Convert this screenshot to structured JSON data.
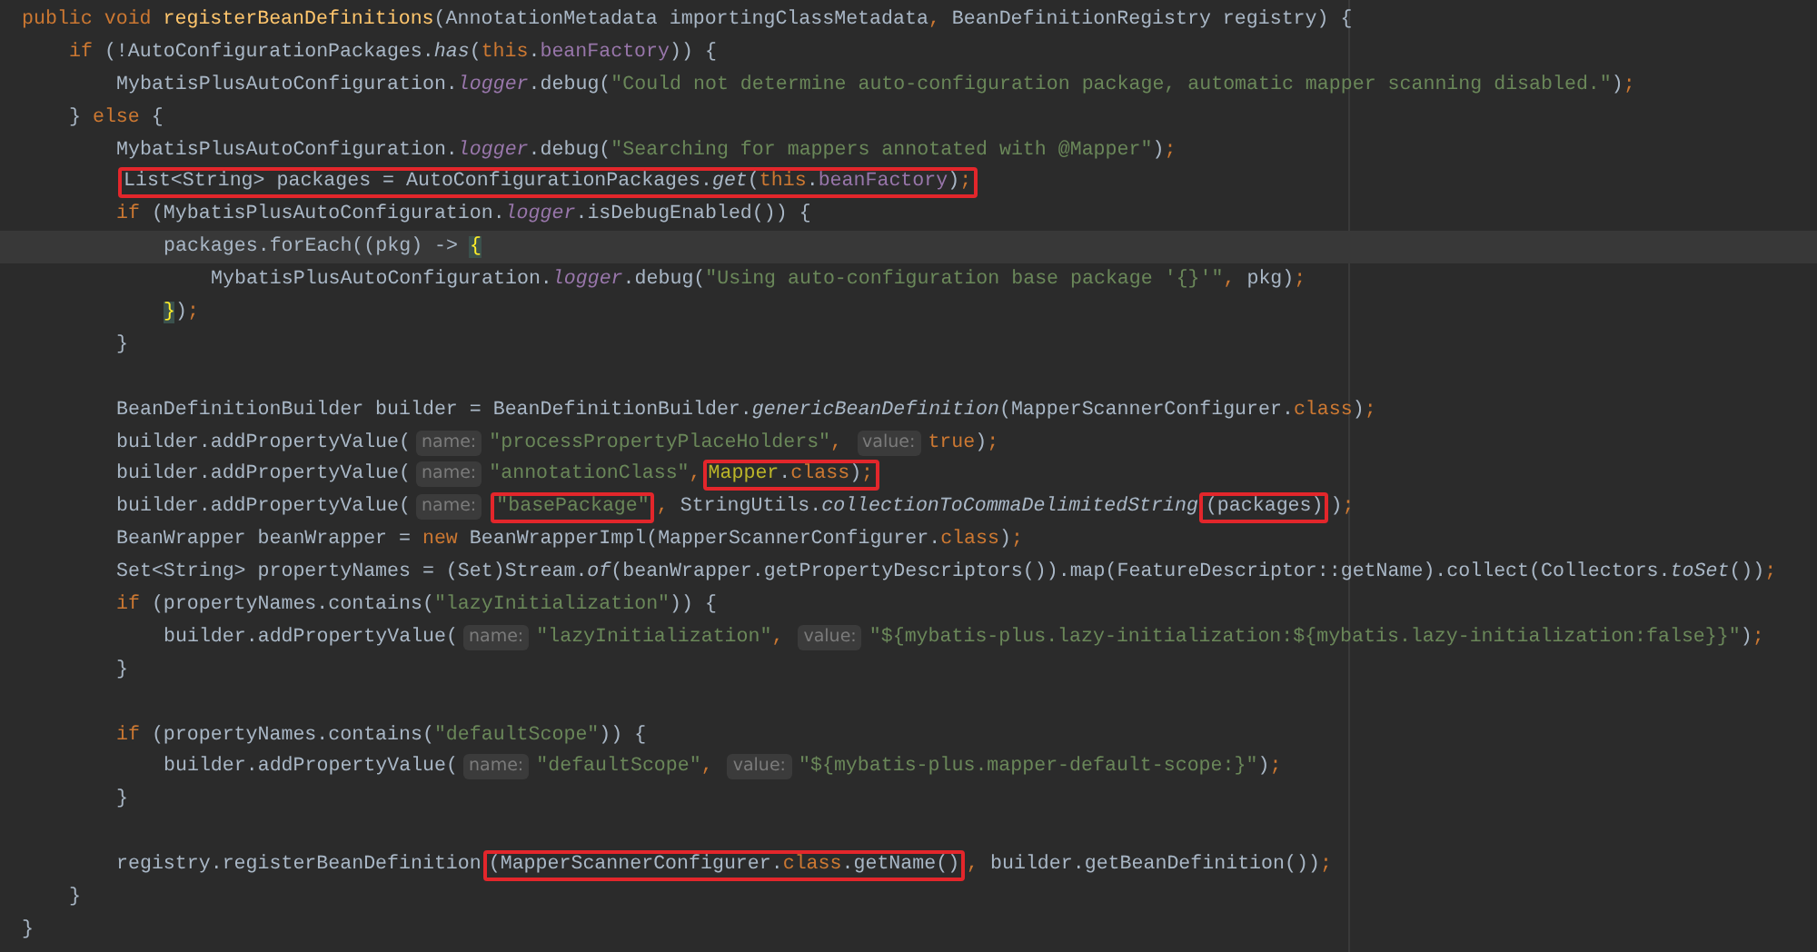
{
  "lines": [
    {
      "current": false,
      "parts": [
        {
          "kind": "code",
          "tokens": [
            {
              "text": "public void",
              "kind": "keyword"
            },
            {
              "text": " registerBeanDefinitions",
              "kind": "declaration"
            },
            {
              "text": "(AnnotationMetadata importingClassMetadata",
              "kind": "plain"
            },
            {
              "text": ", ",
              "kind": "keyword"
            },
            {
              "text": "BeanDefinitionRegistry registry) {",
              "kind": "plain"
            }
          ]
        }
      ],
      "children": [
        {
          "current": false,
          "parts": [
            {
              "kind": "code",
              "tokens": [
                {
                  "text": "if",
                  "kind": "keyword"
                },
                {
                  "text": " (!AutoConfigurationPackages.",
                  "kind": "plain"
                },
                {
                  "text": "has",
                  "kind": "static"
                },
                {
                  "text": "(",
                  "kind": "plain"
                },
                {
                  "text": "this",
                  "kind": "keyword"
                },
                {
                  "text": ".",
                  "kind": "plain"
                },
                {
                  "text": "beanFactory",
                  "kind": "field"
                },
                {
                  "text": ")) {",
                  "kind": "plain"
                }
              ]
            }
          ],
          "children": [
            {
              "current": false,
              "parts": [
                {
                  "kind": "code",
                  "tokens": [
                    {
                      "text": "MybatisPlusAutoConfiguration.",
                      "kind": "plain"
                    },
                    {
                      "text": "logger",
                      "kind": "static-field"
                    },
                    {
                      "text": ".debug(",
                      "kind": "plain"
                    },
                    {
                      "text": "\"Could not determine auto-configuration package, automatic mapper scanning disabled.\"",
                      "kind": "string"
                    },
                    {
                      "text": ")",
                      "kind": "plain"
                    },
                    {
                      "text": ";",
                      "kind": "keyword"
                    }
                  ]
                }
              ]
            }
          ]
        },
        {
          "current": false,
          "parts": [
            {
              "kind": "code",
              "tokens": [
                {
                  "text": "} ",
                  "kind": "plain"
                },
                {
                  "text": "else",
                  "kind": "keyword"
                },
                {
                  "text": " {",
                  "kind": "plain"
                }
              ]
            }
          ],
          "children": [
            {
              "current": false,
              "parts": [
                {
                  "kind": "code",
                  "tokens": [
                    {
                      "text": "MybatisPlusAutoConfiguration.",
                      "kind": "plain"
                    },
                    {
                      "text": "logger",
                      "kind": "static-field"
                    },
                    {
                      "text": ".debug(",
                      "kind": "plain"
                    },
                    {
                      "text": "\"Searching for mappers annotated with @Mapper\"",
                      "kind": "string"
                    },
                    {
                      "text": ")",
                      "kind": "plain"
                    },
                    {
                      "text": ";",
                      "kind": "keyword"
                    }
                  ]
                }
              ]
            },
            {
              "current": false,
              "parts": [
                {
                  "kind": "box",
                  "parts": [
                    {
                      "kind": "code",
                      "tokens": [
                        {
                          "text": "List<String> packages = AutoConfigurationPackages.",
                          "kind": "plain"
                        },
                        {
                          "text": "get",
                          "kind": "static"
                        },
                        {
                          "text": "(",
                          "kind": "plain"
                        },
                        {
                          "text": "this",
                          "kind": "keyword"
                        },
                        {
                          "text": ".",
                          "kind": "plain"
                        },
                        {
                          "text": "beanFactory",
                          "kind": "field"
                        },
                        {
                          "text": ")",
                          "kind": "plain"
                        },
                        {
                          "text": ";",
                          "kind": "keyword"
                        }
                      ]
                    }
                  ]
                }
              ]
            },
            {
              "current": false,
              "parts": [
                {
                  "kind": "code",
                  "tokens": [
                    {
                      "text": "if",
                      "kind": "keyword"
                    },
                    {
                      "text": " (MybatisPlusAutoConfiguration.",
                      "kind": "plain"
                    },
                    {
                      "text": "logger",
                      "kind": "static-field"
                    },
                    {
                      "text": ".isDebugEnabled()) {",
                      "kind": "plain"
                    }
                  ]
                }
              ],
              "children": [
                {
                  "current": true,
                  "parts": [
                    {
                      "kind": "code",
                      "tokens": [
                        {
                          "text": "packages.forEach((pkg) -> ",
                          "kind": "plain"
                        },
                        {
                          "text": "{",
                          "kind": "brace-match"
                        }
                      ]
                    }
                  ],
                  "children": [
                    {
                      "current": false,
                      "parts": [
                        {
                          "kind": "code",
                          "tokens": [
                            {
                              "text": "MybatisPlusAutoConfiguration.",
                              "kind": "plain"
                            },
                            {
                              "text": "logger",
                              "kind": "static-field"
                            },
                            {
                              "text": ".debug(",
                              "kind": "plain"
                            },
                            {
                              "text": "\"Using auto-configuration base package '{}'\"",
                              "kind": "string"
                            },
                            {
                              "text": ", ",
                              "kind": "keyword"
                            },
                            {
                              "text": "pkg)",
                              "kind": "plain"
                            },
                            {
                              "text": ";",
                              "kind": "keyword"
                            }
                          ]
                        }
                      ]
                    }
                  ]
                },
                {
                  "current": false,
                  "parts": [
                    {
                      "kind": "code",
                      "tokens": [
                        {
                          "text": "}",
                          "kind": "brace-match"
                        },
                        {
                          "text": ")",
                          "kind": "plain"
                        },
                        {
                          "text": ";",
                          "kind": "keyword"
                        }
                      ]
                    }
                  ]
                }
              ]
            },
            {
              "current": false,
              "parts": [
                {
                  "kind": "code",
                  "tokens": [
                    {
                      "text": "}",
                      "kind": "plain"
                    }
                  ]
                }
              ]
            },
            {
              "current": false
            },
            {
              "current": false,
              "parts": [
                {
                  "kind": "code",
                  "tokens": [
                    {
                      "text": "BeanDefinitionBuilder builder = BeanDefinitionBuilder.",
                      "kind": "plain"
                    },
                    {
                      "text": "genericBeanDefinition",
                      "kind": "static"
                    },
                    {
                      "text": "(MapperScannerConfigurer.",
                      "kind": "plain"
                    },
                    {
                      "text": "class",
                      "kind": "keyword"
                    },
                    {
                      "text": ")",
                      "kind": "plain"
                    },
                    {
                      "text": ";",
                      "kind": "keyword"
                    }
                  ]
                }
              ]
            },
            {
              "current": false,
              "parts": [
                {
                  "kind": "code",
                  "tokens": [
                    {
                      "text": "builder.addPropertyValue(",
                      "kind": "plain"
                    }
                  ]
                },
                {
                  "kind": "hint",
                  "text": "name:"
                },
                {
                  "kind": "code",
                  "tokens": [
                    {
                      "text": "\"processPropertyPlaceHolders\"",
                      "kind": "string"
                    },
                    {
                      "text": ",",
                      "kind": "keyword"
                    }
                  ]
                },
                {
                  "kind": "hint",
                  "text": "value:"
                },
                {
                  "kind": "code",
                  "tokens": [
                    {
                      "text": "true",
                      "kind": "keyword"
                    },
                    {
                      "text": ")",
                      "kind": "plain"
                    },
                    {
                      "text": ";",
                      "kind": "keyword"
                    }
                  ]
                }
              ]
            },
            {
              "current": false,
              "parts": [
                {
                  "kind": "code",
                  "tokens": [
                    {
                      "text": "builder.addPropertyValue(",
                      "kind": "plain"
                    }
                  ]
                },
                {
                  "kind": "hint",
                  "text": "name:"
                },
                {
                  "kind": "code",
                  "tokens": [
                    {
                      "text": "\"annotationClass\"",
                      "kind": "string"
                    },
                    {
                      "text": ",",
                      "kind": "keyword"
                    }
                  ]
                },
                {
                  "kind": "box",
                  "parts": [
                    {
                      "kind": "code",
                      "tokens": [
                        {
                          "text": "Mapper",
                          "kind": "annotation"
                        },
                        {
                          "text": ".",
                          "kind": "plain"
                        },
                        {
                          "text": "class",
                          "kind": "keyword"
                        },
                        {
                          "text": ")",
                          "kind": "plain"
                        },
                        {
                          "text": ";",
                          "kind": "keyword"
                        }
                      ]
                    }
                  ]
                }
              ]
            },
            {
              "current": false,
              "parts": [
                {
                  "kind": "code",
                  "tokens": [
                    {
                      "text": "builder.addPropertyValue(",
                      "kind": "plain"
                    }
                  ]
                },
                {
                  "kind": "hint",
                  "text": "name:"
                },
                {
                  "kind": "box",
                  "parts": [
                    {
                      "kind": "code",
                      "tokens": [
                        {
                          "text": "\"basePackage\"",
                          "kind": "string"
                        }
                      ]
                    }
                  ]
                },
                {
                  "kind": "code",
                  "tokens": [
                    {
                      "text": ", ",
                      "kind": "keyword"
                    },
                    {
                      "text": "StringUtils.",
                      "kind": "plain"
                    },
                    {
                      "text": "collectionToCommaDelimitedString",
                      "kind": "static"
                    }
                  ]
                },
                {
                  "kind": "box",
                  "parts": [
                    {
                      "kind": "code",
                      "tokens": [
                        {
                          "text": "(packages)",
                          "kind": "plain"
                        }
                      ]
                    }
                  ]
                },
                {
                  "kind": "code",
                  "tokens": [
                    {
                      "text": ")",
                      "kind": "plain"
                    },
                    {
                      "text": ";",
                      "kind": "keyword"
                    }
                  ]
                }
              ]
            },
            {
              "current": false,
              "parts": [
                {
                  "kind": "code",
                  "tokens": [
                    {
                      "text": "BeanWrapper beanWrapper = ",
                      "kind": "plain"
                    },
                    {
                      "text": "new",
                      "kind": "keyword"
                    },
                    {
                      "text": " BeanWrapperImpl(MapperScannerConfigurer.",
                      "kind": "plain"
                    },
                    {
                      "text": "class",
                      "kind": "keyword"
                    },
                    {
                      "text": ")",
                      "kind": "plain"
                    },
                    {
                      "text": ";",
                      "kind": "keyword"
                    }
                  ]
                }
              ]
            },
            {
              "current": false,
              "parts": [
                {
                  "kind": "code",
                  "tokens": [
                    {
                      "text": "Set<String> propertyNames = (Set)Stream.",
                      "kind": "plain"
                    },
                    {
                      "text": "of",
                      "kind": "static"
                    },
                    {
                      "text": "(beanWrapper.getPropertyDescriptors()).map(FeatureDescriptor::getName).collect(Collectors.",
                      "kind": "plain"
                    },
                    {
                      "text": "toSet",
                      "kind": "static"
                    },
                    {
                      "text": "())",
                      "kind": "plain"
                    },
                    {
                      "text": ";",
                      "kind": "keyword"
                    }
                  ]
                }
              ]
            },
            {
              "current": false,
              "parts": [
                {
                  "kind": "code",
                  "tokens": [
                    {
                      "text": "if",
                      "kind": "keyword"
                    },
                    {
                      "text": " (propertyNames.contains(",
                      "kind": "plain"
                    },
                    {
                      "text": "\"lazyInitialization\"",
                      "kind": "string"
                    },
                    {
                      "text": ")) {",
                      "kind": "plain"
                    }
                  ]
                }
              ],
              "children": [
                {
                  "current": false,
                  "parts": [
                    {
                      "kind": "code",
                      "tokens": [
                        {
                          "text": "builder.addPropertyValue(",
                          "kind": "plain"
                        }
                      ]
                    },
                    {
                      "kind": "hint",
                      "text": "name:"
                    },
                    {
                      "kind": "code",
                      "tokens": [
                        {
                          "text": "\"lazyInitialization\"",
                          "kind": "string"
                        },
                        {
                          "text": ",",
                          "kind": "keyword"
                        }
                      ]
                    },
                    {
                      "kind": "hint",
                      "text": "value:"
                    },
                    {
                      "kind": "code",
                      "tokens": [
                        {
                          "text": "\"${mybatis-plus.lazy-initialization:${mybatis.lazy-initialization:false}}\"",
                          "kind": "string"
                        },
                        {
                          "text": ")",
                          "kind": "plain"
                        },
                        {
                          "text": ";",
                          "kind": "keyword"
                        }
                      ]
                    }
                  ]
                }
              ]
            },
            {
              "current": false,
              "parts": [
                {
                  "kind": "code",
                  "tokens": [
                    {
                      "text": "}",
                      "kind": "plain"
                    }
                  ]
                }
              ]
            },
            {
              "current": false
            },
            {
              "current": false,
              "parts": [
                {
                  "kind": "code",
                  "tokens": [
                    {
                      "text": "if",
                      "kind": "keyword"
                    },
                    {
                      "text": " (propertyNames.contains(",
                      "kind": "plain"
                    },
                    {
                      "text": "\"defaultScope\"",
                      "kind": "string"
                    },
                    {
                      "text": ")) {",
                      "kind": "plain"
                    }
                  ]
                }
              ],
              "children": [
                {
                  "current": false,
                  "parts": [
                    {
                      "kind": "code",
                      "tokens": [
                        {
                          "text": "builder.addPropertyValue(",
                          "kind": "plain"
                        }
                      ]
                    },
                    {
                      "kind": "hint",
                      "text": "name:"
                    },
                    {
                      "kind": "code",
                      "tokens": [
                        {
                          "text": "\"defaultScope\"",
                          "kind": "string"
                        },
                        {
                          "text": ",",
                          "kind": "keyword"
                        }
                      ]
                    },
                    {
                      "kind": "hint",
                      "text": "value:"
                    },
                    {
                      "kind": "code",
                      "tokens": [
                        {
                          "text": "\"${mybatis-plus.mapper-default-scope:}\"",
                          "kind": "string"
                        },
                        {
                          "text": ")",
                          "kind": "plain"
                        },
                        {
                          "text": ";",
                          "kind": "keyword"
                        }
                      ]
                    }
                  ]
                }
              ]
            },
            {
              "current": false,
              "parts": [
                {
                  "kind": "code",
                  "tokens": [
                    {
                      "text": "}",
                      "kind": "plain"
                    }
                  ]
                }
              ]
            },
            {
              "current": false
            },
            {
              "current": false,
              "parts": [
                {
                  "kind": "code",
                  "tokens": [
                    {
                      "text": "registry.registerBeanDefinition",
                      "kind": "plain"
                    }
                  ]
                },
                {
                  "kind": "box",
                  "parts": [
                    {
                      "kind": "code",
                      "tokens": [
                        {
                          "text": "(MapperScannerConfigurer.",
                          "kind": "plain"
                        },
                        {
                          "text": "class",
                          "kind": "keyword"
                        },
                        {
                          "text": ".getName()",
                          "kind": "plain"
                        }
                      ]
                    }
                  ]
                },
                {
                  "kind": "code",
                  "tokens": [
                    {
                      "text": ", ",
                      "kind": "keyword"
                    },
                    {
                      "text": "builder.getBeanDefinition())",
                      "kind": "plain"
                    },
                    {
                      "text": ";",
                      "kind": "keyword"
                    }
                  ]
                }
              ]
            }
          ]
        },
        {
          "current": false,
          "parts": [
            {
              "kind": "code",
              "tokens": [
                {
                  "text": "}",
                  "kind": "plain"
                }
              ]
            }
          ]
        }
      ]
    },
    {
      "current": false,
      "parts": [
        {
          "kind": "code",
          "tokens": [
            {
              "text": "}",
              "kind": "plain"
            }
          ]
        }
      ]
    }
  ]
}
